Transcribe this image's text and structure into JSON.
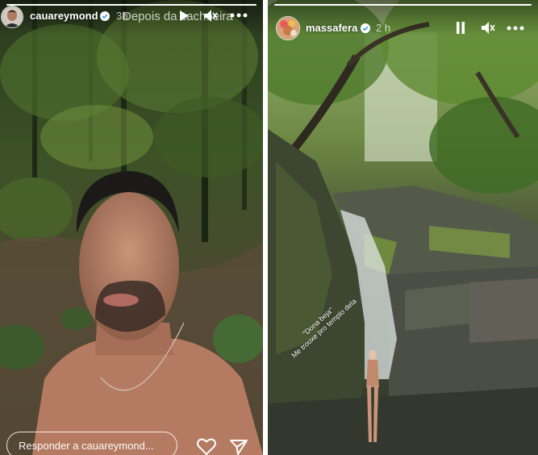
{
  "left_story": {
    "username": "cauareymond",
    "time": "3h",
    "overlay_text": "Depois da cachoeira",
    "reply_placeholder": "Responder a cauareymond...",
    "progress": 1.0
  },
  "right_story": {
    "username": "massafera",
    "time": "2 h",
    "sticker_line1": "\"Dona beja\"",
    "sticker_line2": "Me trouxe pro templo dela",
    "progress": 1.0
  },
  "icons": {
    "play": "play-icon",
    "pause": "pause-icon",
    "mute": "speaker-muted-icon",
    "more": "more-icon",
    "heart": "heart-icon",
    "send": "send-icon",
    "verified": "verified-badge-icon"
  },
  "colors": {
    "verified": "#3897f0",
    "text": "#ffffff"
  }
}
